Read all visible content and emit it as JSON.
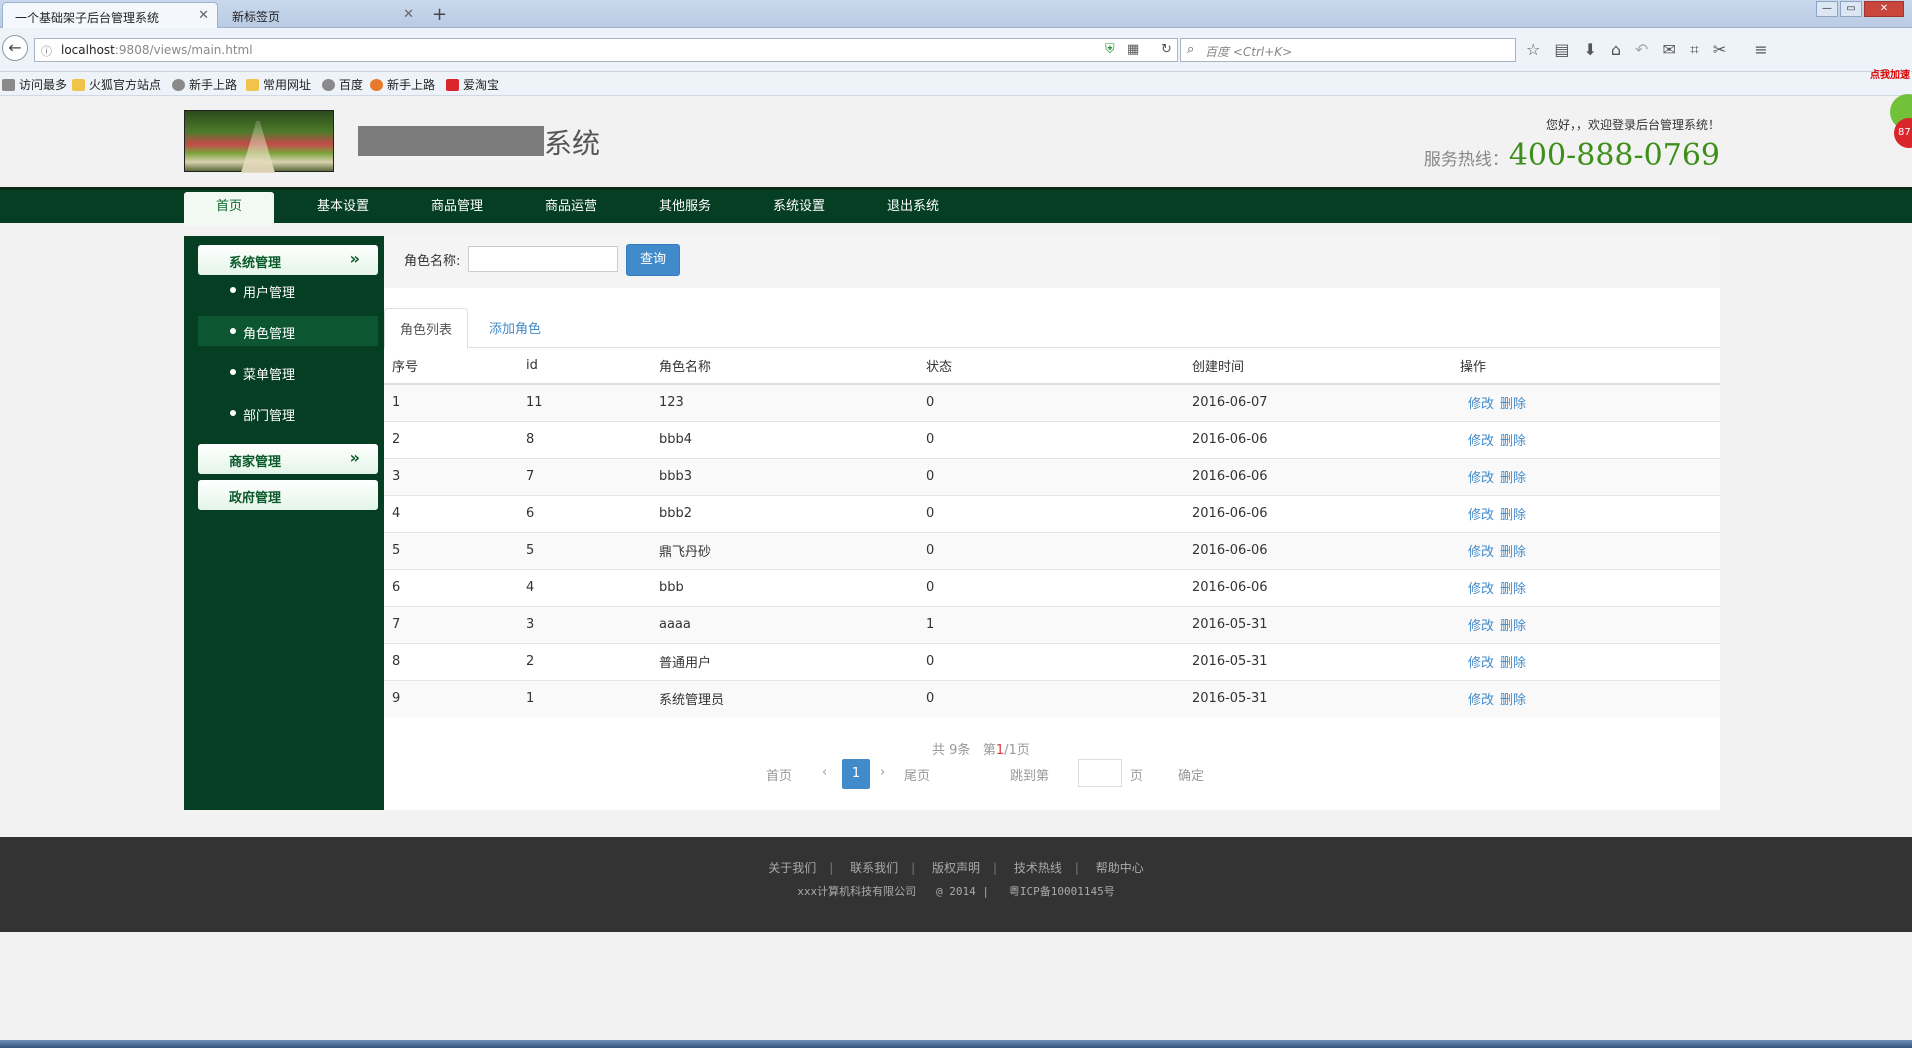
{
  "browser": {
    "tabs": [
      {
        "title": "一个基础架子后台管理系统",
        "active": true
      },
      {
        "title": "新标签页",
        "active": false
      }
    ],
    "url_host": "localhost",
    "url_path": ":9808/views/main.html",
    "search_placeholder": "百度 <Ctrl+K>",
    "bookmarks": [
      {
        "label": "访问最多",
        "color": "#f2c34a"
      },
      {
        "label": "火狐官方站点",
        "color": "#f2c34a"
      },
      {
        "label": "新手上路",
        "color": "#8a8a8a"
      },
      {
        "label": "常用网址",
        "color": "#f2c34a"
      },
      {
        "label": "百度",
        "color": "#8a8a8a"
      },
      {
        "label": "新手上路",
        "color": "#e8782a"
      },
      {
        "label": "爱淘宝",
        "color": "#d9252b"
      }
    ]
  },
  "header": {
    "title_suffix": "系统",
    "welcome": "您好，，欢迎登录后台管理系统！",
    "hotline_label": "服务热线：",
    "hotline_number": "400-888-0769"
  },
  "nav": {
    "items": [
      "首页",
      "基本设置",
      "商品管理",
      "商品运营",
      "其他服务",
      "系统设置",
      "退出系统"
    ],
    "active_index": 0
  },
  "sidebar": {
    "groups": [
      {
        "label": "系统管理",
        "expanded": true,
        "items": [
          "用户管理",
          "角色管理",
          "菜单管理",
          "部门管理"
        ],
        "active_item": 1
      },
      {
        "label": "商家管理",
        "expanded": false
      },
      {
        "label": "政府管理",
        "expanded": false
      }
    ]
  },
  "search": {
    "label": "角色名称:",
    "value": "",
    "button": "查询"
  },
  "tabs": [
    "角色列表",
    "添加角色"
  ],
  "table": {
    "headers": [
      "序号",
      "id",
      "角色名称",
      "状态",
      "创建时间",
      "操作"
    ],
    "actions": [
      "修改",
      "删除"
    ],
    "rows": [
      [
        "1",
        "11",
        "123",
        "0",
        "2016-06-07"
      ],
      [
        "2",
        "8",
        "bbb4",
        "0",
        "2016-06-06"
      ],
      [
        "3",
        "7",
        "bbb3",
        "0",
        "2016-06-06"
      ],
      [
        "4",
        "6",
        "bbb2",
        "0",
        "2016-06-06"
      ],
      [
        "5",
        "5",
        "鼎飞丹砂",
        "0",
        "2016-06-06"
      ],
      [
        "6",
        "4",
        "bbb",
        "0",
        "2016-06-06"
      ],
      [
        "7",
        "3",
        "aaaa",
        "1",
        "2016-05-31"
      ],
      [
        "8",
        "2",
        "普通用户",
        "0",
        "2016-05-31"
      ],
      [
        "9",
        "1",
        "系统管理员",
        "0",
        "2016-05-31"
      ]
    ]
  },
  "pagination": {
    "total_prefix": "共 ",
    "total": "9",
    "total_suffix": "条",
    "page_prefix": "第",
    "current": "1",
    "page_suffix": "/1页",
    "first": "首页",
    "prev": "‹",
    "page": "1",
    "next": "›",
    "last": "尾页",
    "jump_label": "跳到第",
    "jump_unit": "页",
    "confirm": "确定"
  },
  "footer": {
    "links": [
      "关于我们",
      "联系我们",
      "版权声明",
      "技术热线",
      "帮助中心"
    ],
    "company": "xxx计算机科技有限公司",
    "copyright": "@ 2014",
    "icp": "粤ICP备10001145号"
  },
  "float_widget": {
    "tag": "点我加速",
    "badge": "87"
  }
}
